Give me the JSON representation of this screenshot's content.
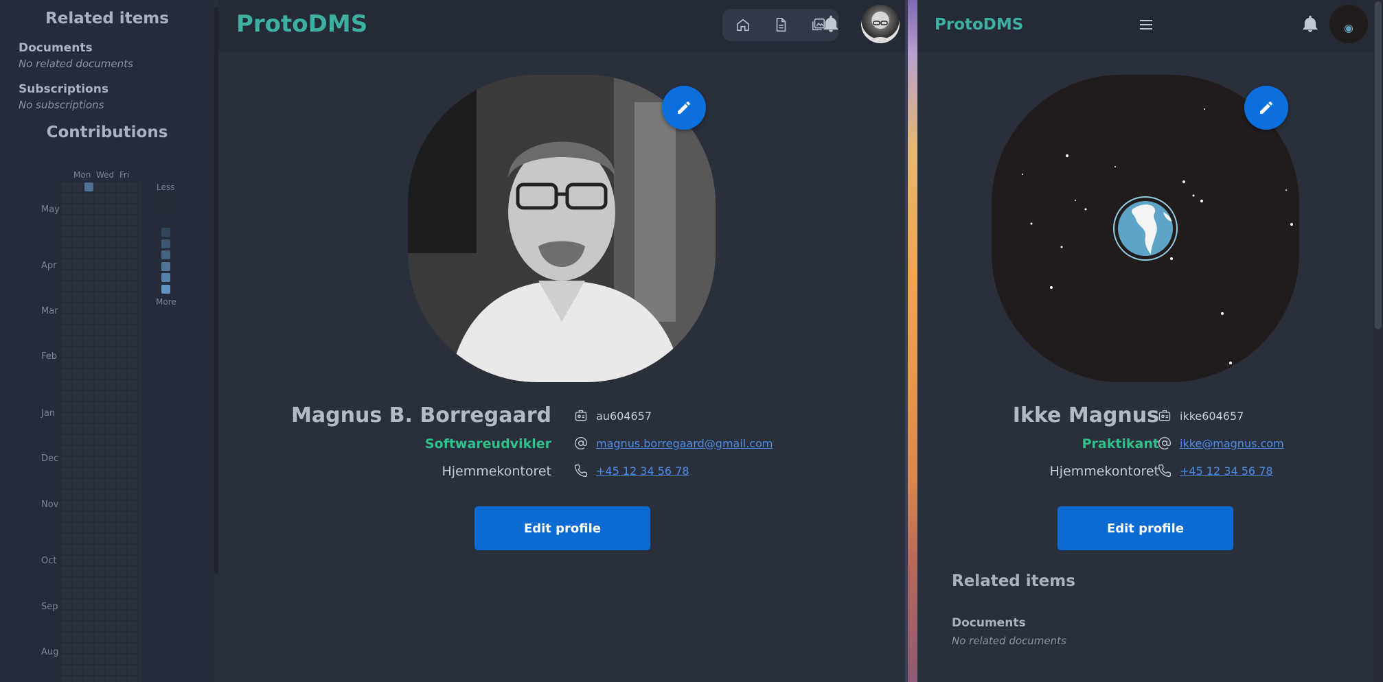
{
  "app": {
    "name": "ProtoDMS"
  },
  "sidebar": {
    "title": "Related items",
    "documents_label": "Documents",
    "documents_empty": "No related documents",
    "subscriptions_label": "Subscriptions",
    "subscriptions_empty": "No subscriptions",
    "contributions_title": "Contributions",
    "days": [
      "Mon",
      "Wed",
      "Fri"
    ],
    "months": [
      "May",
      "Apr",
      "Mar",
      "Feb",
      "Jan",
      "Dec",
      "Nov",
      "Oct",
      "Sep",
      "Aug"
    ],
    "legend_less": "Less",
    "legend_more": "More"
  },
  "profile_left": {
    "name": "Magnus B. Borregaard",
    "role": "Softwareudvikler",
    "office": "Hjemmekontoret",
    "user_id": "au604657",
    "email": "magnus.borregaard@gmail.com",
    "phone": "+45 12 34 56 78",
    "edit_button": "Edit profile"
  },
  "profile_right": {
    "name": "Ikke Magnus",
    "role": "Praktikant",
    "office": "Hjemmekontoret",
    "user_id": "ikke604657",
    "email": "ikke@magnus.com",
    "phone": "+45 12 34 56 78",
    "edit_button": "Edit profile",
    "related_title": "Related items",
    "documents_label": "Documents",
    "documents_empty": "No related documents"
  },
  "colors": {
    "accent": "#0b6fdd",
    "brand": "#3db0a1",
    "role": "#2fc08b",
    "link": "#4c8de6"
  }
}
